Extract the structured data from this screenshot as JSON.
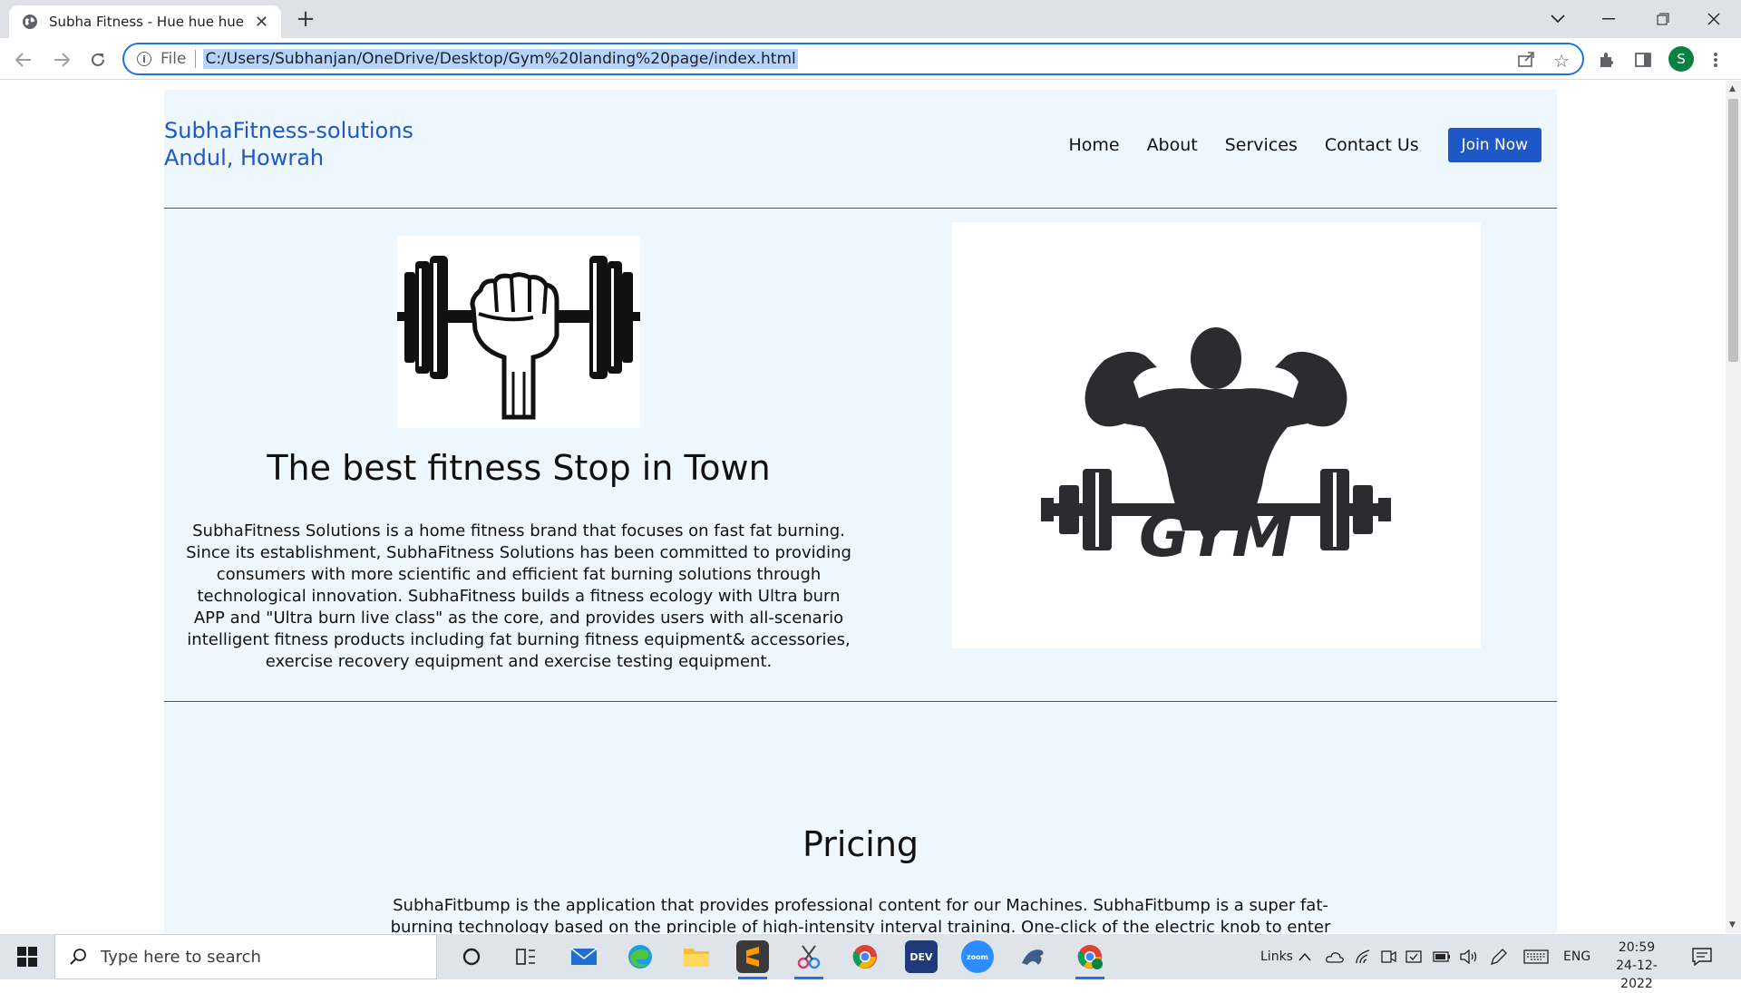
{
  "browser": {
    "tab_title": "Subha Fitness - Hue hue hue",
    "scheme_label": "File",
    "url": "C:/Users/Subhanjan/OneDrive/Desktop/Gym%20landing%20page/index.html",
    "profile_initial": "S"
  },
  "site": {
    "brand_line1": "SubhaFitness-solutions",
    "brand_line2": "Andul, Howrah",
    "nav": [
      "Home",
      "About",
      "Services",
      "Contact Us"
    ],
    "join_label": "Join Now",
    "hero_title": "The best fitness Stop in Town",
    "hero_desc": "SubhaFitness Solutions is a home fitness brand that focuses on fast fat burning. Since its establishment, SubhaFitness Solutions has been committed to providing consumers with more scientific and efficient fat burning solutions through technological innovation. SubhaFitness builds a fitness ecology with Ultra burn APP and \"Ultra burn live class\" as the core, and provides users with all-scenario intelligent fitness products including fat burning fitness equipment& accessories, exercise recovery equipment and exercise testing equipment.",
    "gym_logo_text": "GYM",
    "pricing_title": "Pricing",
    "pricing_desc": "SubhaFitbump is the application that provides professional content for our Machines. SubhaFitbump is a super fat-burning technology based on the principle of high-intensity interval training. One-click of the electric knob to enter"
  },
  "taskbar": {
    "search_placeholder": "Type here to search",
    "links_label": "Links",
    "language": "ENG",
    "time": "20:59",
    "date": "24-12-2022"
  }
}
